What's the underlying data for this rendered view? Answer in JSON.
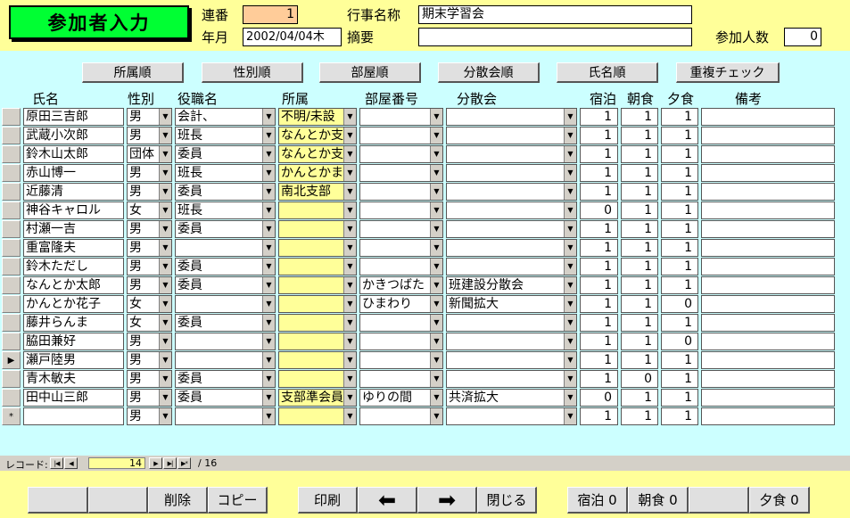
{
  "header": {
    "title": "参加者入力",
    "serial_label": "連番",
    "serial_value": "1",
    "event_label": "行事名称",
    "event_value": "期末学習会",
    "date_label": "年月",
    "date_value": "2002/04/04木",
    "summary_label": "摘要",
    "summary_value": "",
    "participants_label": "参加人数",
    "participants_value": "0"
  },
  "sort_buttons": [
    "所属順",
    "性別順",
    "部屋順",
    "分散会順",
    "氏名順",
    "重複チェック"
  ],
  "columns": {
    "name": "氏名",
    "gender": "性別",
    "role": "役職名",
    "affil": "所属",
    "room": "部屋番号",
    "group": "分散会",
    "stay": "宿泊",
    "breakfast": "朝食",
    "dinner": "夕食",
    "note": "備考"
  },
  "rows": [
    {
      "name": "原田三吉郎",
      "gender": "男",
      "role": "会計、",
      "affil": "不明/未設",
      "room": "",
      "group": "",
      "stay": "1",
      "breakfast": "1",
      "dinner": "1",
      "note": ""
    },
    {
      "name": "武蔵小次郎",
      "gender": "男",
      "role": "班長",
      "affil": "なんとか支",
      "room": "",
      "group": "",
      "stay": "1",
      "breakfast": "1",
      "dinner": "1",
      "note": ""
    },
    {
      "name": "鈴木山太郎",
      "gender": "団体",
      "role": "委員",
      "affil": "なんとか支",
      "room": "",
      "group": "",
      "stay": "1",
      "breakfast": "1",
      "dinner": "1",
      "note": ""
    },
    {
      "name": "赤山博一",
      "gender": "男",
      "role": "班長",
      "affil": "かんとかま",
      "room": "",
      "group": "",
      "stay": "1",
      "breakfast": "1",
      "dinner": "1",
      "note": ""
    },
    {
      "name": "近藤清",
      "gender": "男",
      "role": "委員",
      "affil": "南北支部",
      "room": "",
      "group": "",
      "stay": "1",
      "breakfast": "1",
      "dinner": "1",
      "note": ""
    },
    {
      "name": "神谷キャロル",
      "gender": "女",
      "role": "班長",
      "affil": "",
      "room": "",
      "group": "",
      "stay": "0",
      "breakfast": "1",
      "dinner": "1",
      "note": ""
    },
    {
      "name": "村瀬一吉",
      "gender": "男",
      "role": "委員",
      "affil": "",
      "room": "",
      "group": "",
      "stay": "1",
      "breakfast": "1",
      "dinner": "1",
      "note": ""
    },
    {
      "name": "重富隆夫",
      "gender": "男",
      "role": "",
      "affil": "",
      "room": "",
      "group": "",
      "stay": "1",
      "breakfast": "1",
      "dinner": "1",
      "note": ""
    },
    {
      "name": "鈴木ただし",
      "gender": "男",
      "role": "委員",
      "affil": "",
      "room": "",
      "group": "",
      "stay": "1",
      "breakfast": "1",
      "dinner": "1",
      "note": ""
    },
    {
      "name": "なんとか太郎",
      "gender": "男",
      "role": "委員",
      "affil": "",
      "room": "かきつばた",
      "group": "班建設分散会",
      "stay": "1",
      "breakfast": "1",
      "dinner": "1",
      "note": ""
    },
    {
      "name": "かんとか花子",
      "gender": "女",
      "role": "",
      "affil": "",
      "room": "ひまわり",
      "group": "新聞拡大",
      "stay": "1",
      "breakfast": "1",
      "dinner": "0",
      "note": ""
    },
    {
      "name": "藤井らんま",
      "gender": "女",
      "role": "委員",
      "affil": "",
      "room": "",
      "group": "",
      "stay": "1",
      "breakfast": "1",
      "dinner": "1",
      "note": ""
    },
    {
      "name": "脇田兼好",
      "gender": "男",
      "role": "",
      "affil": "",
      "room": "",
      "group": "",
      "stay": "1",
      "breakfast": "1",
      "dinner": "0",
      "note": ""
    },
    {
      "name": "瀬戸陸男",
      "gender": "男",
      "role": "",
      "affil": "",
      "room": "",
      "group": "",
      "stay": "1",
      "breakfast": "1",
      "dinner": "1",
      "note": ""
    },
    {
      "name": "青木敏夫",
      "gender": "男",
      "role": "委員",
      "affil": "",
      "room": "",
      "group": "",
      "stay": "1",
      "breakfast": "0",
      "dinner": "1",
      "note": ""
    },
    {
      "name": "田中山三郎",
      "gender": "男",
      "role": "委員",
      "affil": "支部準会員",
      "room": "ゆりの間",
      "group": "共済拡大",
      "stay": "0",
      "breakfast": "1",
      "dinner": "1",
      "note": ""
    },
    {
      "name": "",
      "gender": "男",
      "role": "",
      "affil": "",
      "room": "",
      "group": "",
      "stay": "1",
      "breakfast": "1",
      "dinner": "1",
      "note": ""
    }
  ],
  "current_row_marker": "▶",
  "new_row_marker": "*",
  "nav": {
    "label": "レコード:",
    "current": "14",
    "total": "/ 16",
    "first_glyph": "|◀",
    "prev_glyph": "◀",
    "next_glyph": "▶",
    "last_glyph": "▶|",
    "new_glyph": "▶*"
  },
  "footer": {
    "delete": "削除",
    "copy": "コピー",
    "print": "印刷",
    "prev_glyph": "⬅",
    "next_glyph": "➡",
    "close": "閉じる",
    "stay_total": "宿泊 0",
    "breakfast_total": "朝食 0",
    "dinner_total": "夕食 0"
  }
}
